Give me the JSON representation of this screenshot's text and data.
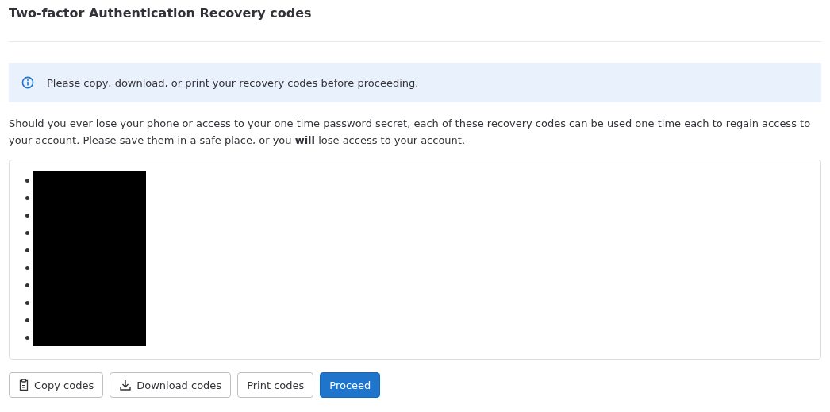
{
  "title": "Two-factor Authentication Recovery codes",
  "alert": {
    "text": "Please copy, download, or print your recovery codes before proceeding."
  },
  "description": "Should you ever lose your phone or access to your one time password secret, each of these recovery codes can be used one time each to regain access to your account. Please save them in a safe place, or you **will** lose access to your account.",
  "codes": [
    {
      "redacted": true
    },
    {
      "redacted": true
    },
    {
      "redacted": true
    },
    {
      "redacted": true
    },
    {
      "redacted": true
    },
    {
      "redacted": true
    },
    {
      "redacted": true
    },
    {
      "redacted": true
    },
    {
      "redacted": true
    },
    {
      "redacted": true
    }
  ],
  "buttons": [
    {
      "label": "Copy codes",
      "kind": "copy"
    },
    {
      "label": "Download codes",
      "kind": "download"
    },
    {
      "label": "Print codes",
      "kind": "plain"
    },
    {
      "label": "Proceed",
      "kind": "primary"
    }
  ]
}
